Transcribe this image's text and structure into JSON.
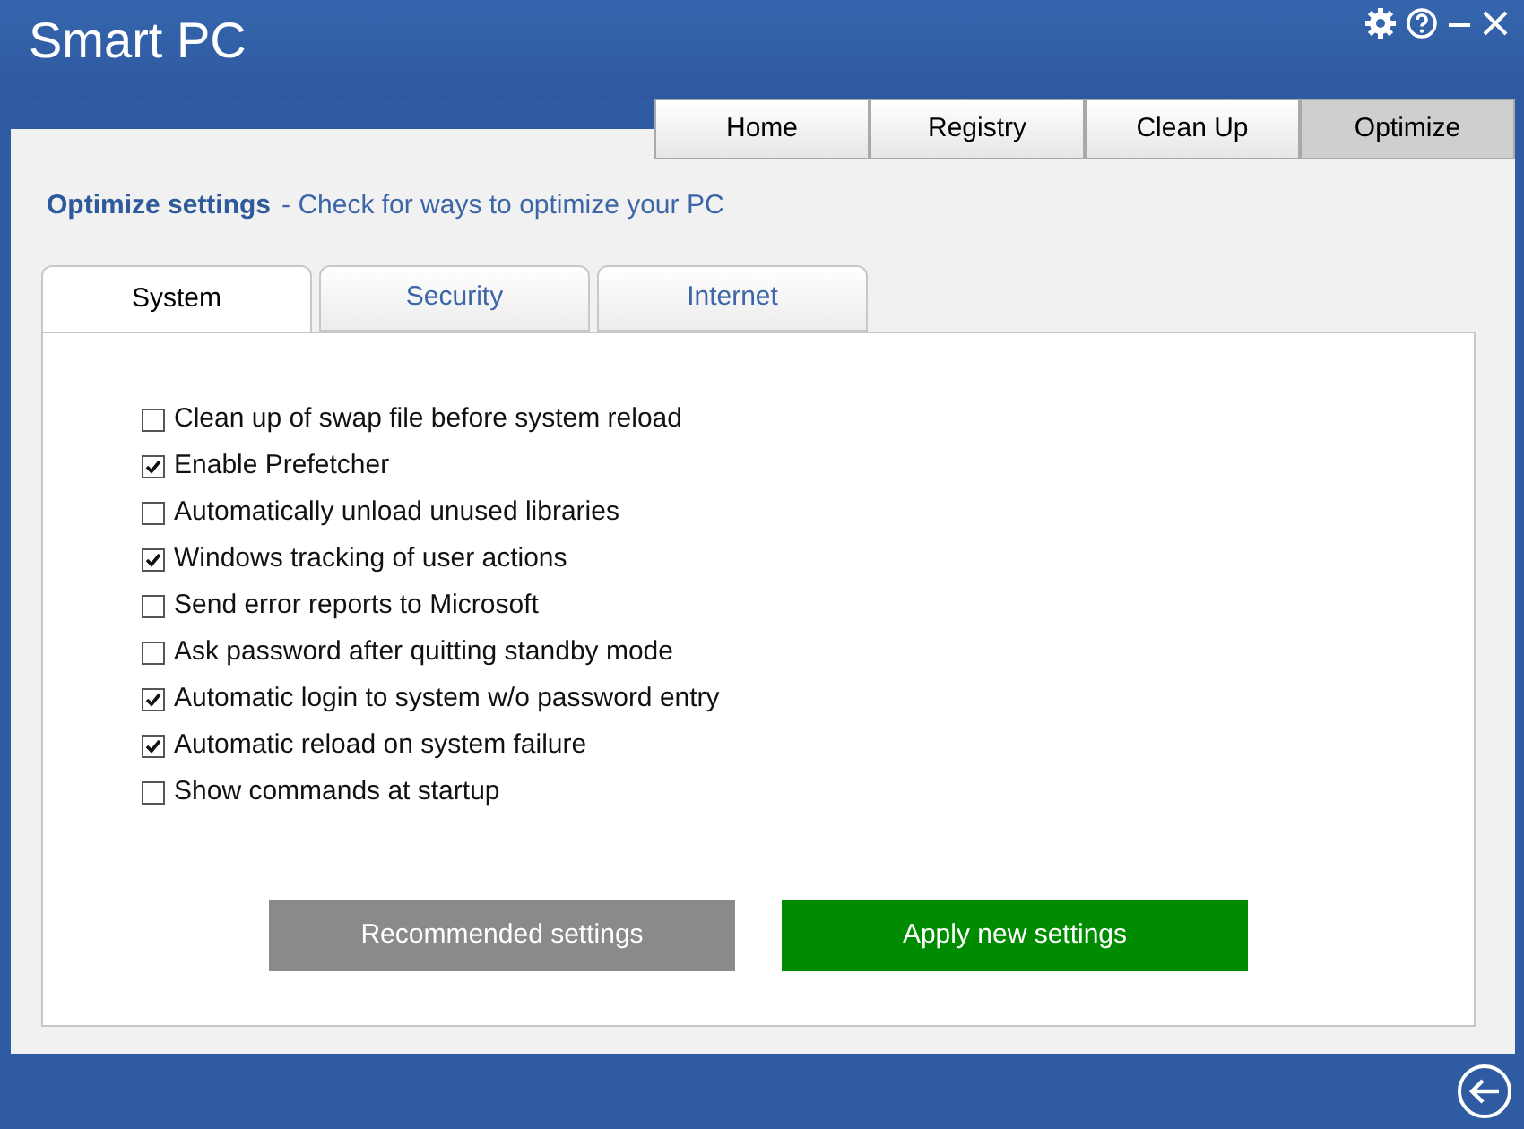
{
  "window": {
    "title": "Smart PC"
  },
  "nav_tabs": [
    {
      "label": "Home",
      "selected": false
    },
    {
      "label": "Registry",
      "selected": false
    },
    {
      "label": "Clean Up",
      "selected": false
    },
    {
      "label": "Optimize",
      "selected": true
    }
  ],
  "heading": {
    "title": "Optimize settings",
    "subtitle": "- Check for ways to optimize your PC"
  },
  "tabs": [
    {
      "label": "System",
      "selected": true
    },
    {
      "label": "Security",
      "selected": false
    },
    {
      "label": "Internet",
      "selected": false
    }
  ],
  "options": [
    {
      "label": "Clean up of swap file before system reload",
      "checked": false
    },
    {
      "label": "Enable Prefetcher",
      "checked": true
    },
    {
      "label": "Automatically unload unused libraries",
      "checked": false
    },
    {
      "label": "Windows tracking of user actions",
      "checked": true
    },
    {
      "label": "Send error reports to Microsoft",
      "checked": false
    },
    {
      "label": "Ask password after quitting standby mode",
      "checked": false
    },
    {
      "label": "Automatic login to system w/o password entry",
      "checked": true
    },
    {
      "label": "Automatic reload on system failure",
      "checked": true
    },
    {
      "label": "Show commands at startup",
      "checked": false
    }
  ],
  "buttons": [
    {
      "label": "Recommended settings",
      "kind": "secondary"
    },
    {
      "label": "Apply new settings",
      "kind": "primary"
    }
  ]
}
